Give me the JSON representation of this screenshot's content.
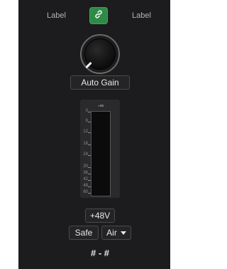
{
  "labels": {
    "left": "Label",
    "right": "Label"
  },
  "link": {
    "icon": "link-icon",
    "accent": "#2f8a47"
  },
  "gain": {
    "auto_gain_label": "Auto Gain"
  },
  "meter": {
    "peak": "-∞",
    "scale": [
      "0",
      "6",
      "12",
      "18",
      "24",
      "30",
      "36",
      "42",
      "48",
      "60"
    ]
  },
  "controls": {
    "phantom_label": "+48V",
    "safe_label": "Safe",
    "air_label": "Air"
  },
  "channel_label": "# - #"
}
